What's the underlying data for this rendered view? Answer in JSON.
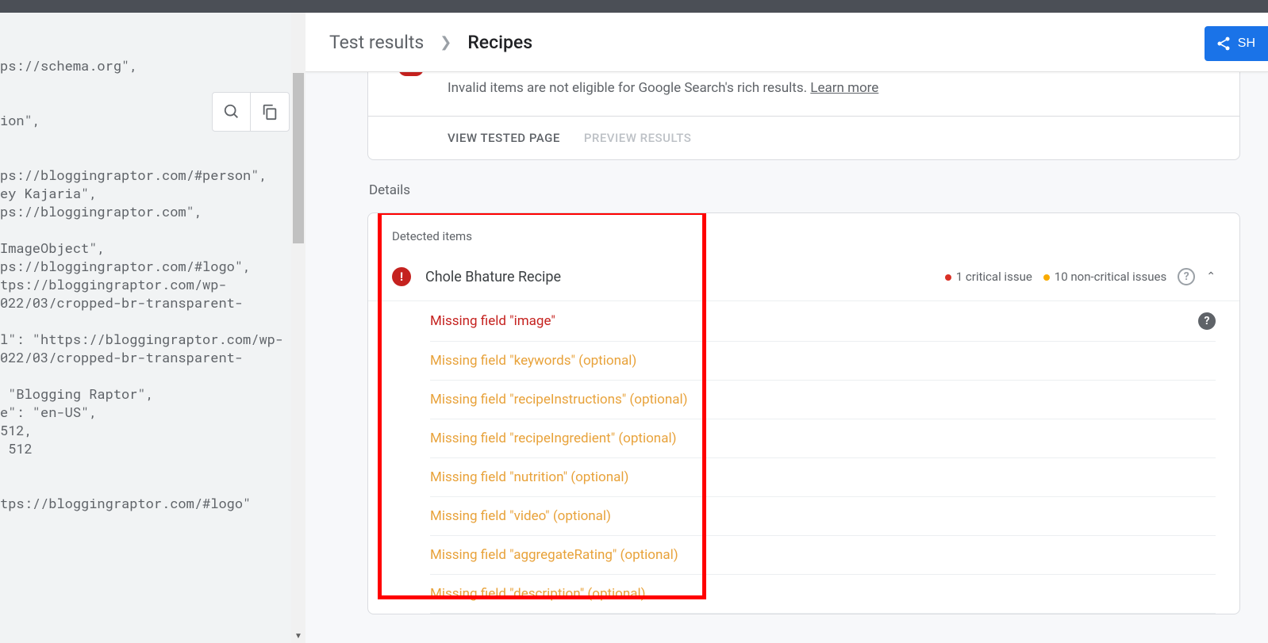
{
  "breadcrumb": {
    "root": "Test results",
    "current": "Recipes"
  },
  "share_label": "SH",
  "info": {
    "message": "Invalid items are not eligible for Google Search's rich results. ",
    "learn_more": "Learn more"
  },
  "actions": {
    "view_tested": "VIEW TESTED PAGE",
    "preview": "PREVIEW RESULTS"
  },
  "details_label": "Details",
  "detected_items_label": "Detected items",
  "item": {
    "title": "Chole Bhature Recipe",
    "critical_count": "1 critical issue",
    "noncritical_count": "10 non-critical issues"
  },
  "issues": [
    {
      "text": "Missing field \"image\"",
      "severity": "critical",
      "has_help": true
    },
    {
      "text": "Missing field \"keywords\" (optional)",
      "severity": "warning",
      "has_help": false
    },
    {
      "text": "Missing field \"recipeInstructions\" (optional)",
      "severity": "warning",
      "has_help": false
    },
    {
      "text": "Missing field \"recipeIngredient\" (optional)",
      "severity": "warning",
      "has_help": false
    },
    {
      "text": "Missing field \"nutrition\" (optional)",
      "severity": "warning",
      "has_help": false
    },
    {
      "text": "Missing field \"video\" (optional)",
      "severity": "warning",
      "has_help": false
    },
    {
      "text": "Missing field \"aggregateRating\" (optional)",
      "severity": "warning",
      "has_help": false
    },
    {
      "text": "Missing field \"description\" (optional)",
      "severity": "warning",
      "has_help": false
    }
  ],
  "code_snippet": "ps://schema.org\",\n\n\nion\",\n\n\nps://bloggingraptor.com/#person\",\ney Kajaria\",\nps://bloggingraptor.com\",\n\nImageObject\",\nps://bloggingraptor.com/#logo\",\ntps://bloggingraptor.com/wp-\n022/03/cropped-br-transparent-\n\nl\": \"https://bloggingraptor.com/wp-\n022/03/cropped-br-transparent-\n\n \"Blogging Raptor\",\ne\": \"en-US\",\n512,\n 512\n\n\ntps://bloggingraptor.com/#logo\""
}
